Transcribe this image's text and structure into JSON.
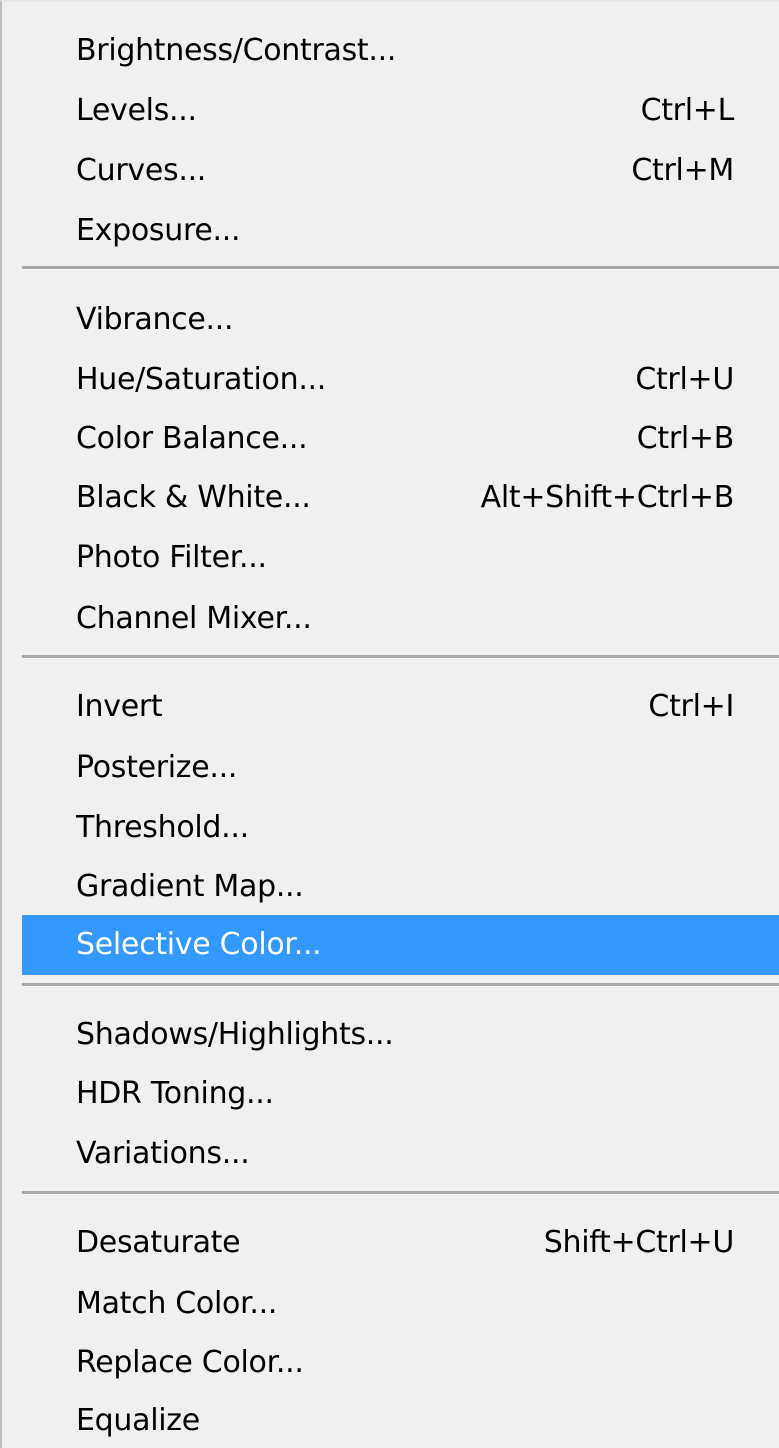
{
  "menu": {
    "groups": [
      {
        "items": [
          {
            "label": "Brightness/Contrast...",
            "shortcut": ""
          },
          {
            "label": "Levels...",
            "shortcut": "Ctrl+L"
          },
          {
            "label": "Curves...",
            "shortcut": "Ctrl+M"
          },
          {
            "label": "Exposure...",
            "shortcut": ""
          }
        ]
      },
      {
        "items": [
          {
            "label": "Vibrance...",
            "shortcut": ""
          },
          {
            "label": "Hue/Saturation...",
            "shortcut": "Ctrl+U"
          },
          {
            "label": "Color Balance...",
            "shortcut": "Ctrl+B"
          },
          {
            "label": "Black & White...",
            "shortcut": "Alt+Shift+Ctrl+B"
          },
          {
            "label": "Photo Filter...",
            "shortcut": ""
          },
          {
            "label": "Channel Mixer...",
            "shortcut": ""
          }
        ]
      },
      {
        "items": [
          {
            "label": "Invert",
            "shortcut": "Ctrl+I"
          },
          {
            "label": "Posterize...",
            "shortcut": ""
          },
          {
            "label": "Threshold...",
            "shortcut": ""
          },
          {
            "label": "Gradient Map...",
            "shortcut": ""
          },
          {
            "label": "Selective Color...",
            "shortcut": ""
          }
        ]
      },
      {
        "items": [
          {
            "label": "Shadows/Highlights...",
            "shortcut": ""
          },
          {
            "label": "HDR Toning...",
            "shortcut": ""
          },
          {
            "label": "Variations...",
            "shortcut": ""
          }
        ]
      },
      {
        "items": [
          {
            "label": "Desaturate",
            "shortcut": "Shift+Ctrl+U"
          },
          {
            "label": "Match Color...",
            "shortcut": ""
          },
          {
            "label": "Replace Color...",
            "shortcut": ""
          },
          {
            "label": "Equalize",
            "shortcut": ""
          }
        ]
      }
    ],
    "highlighted_item": "Selective Color...",
    "colors": {
      "background": "#f0f0f0",
      "highlight": "#3399ff",
      "highlight_text": "#ffffff",
      "separator": "#a8a8a8"
    }
  }
}
